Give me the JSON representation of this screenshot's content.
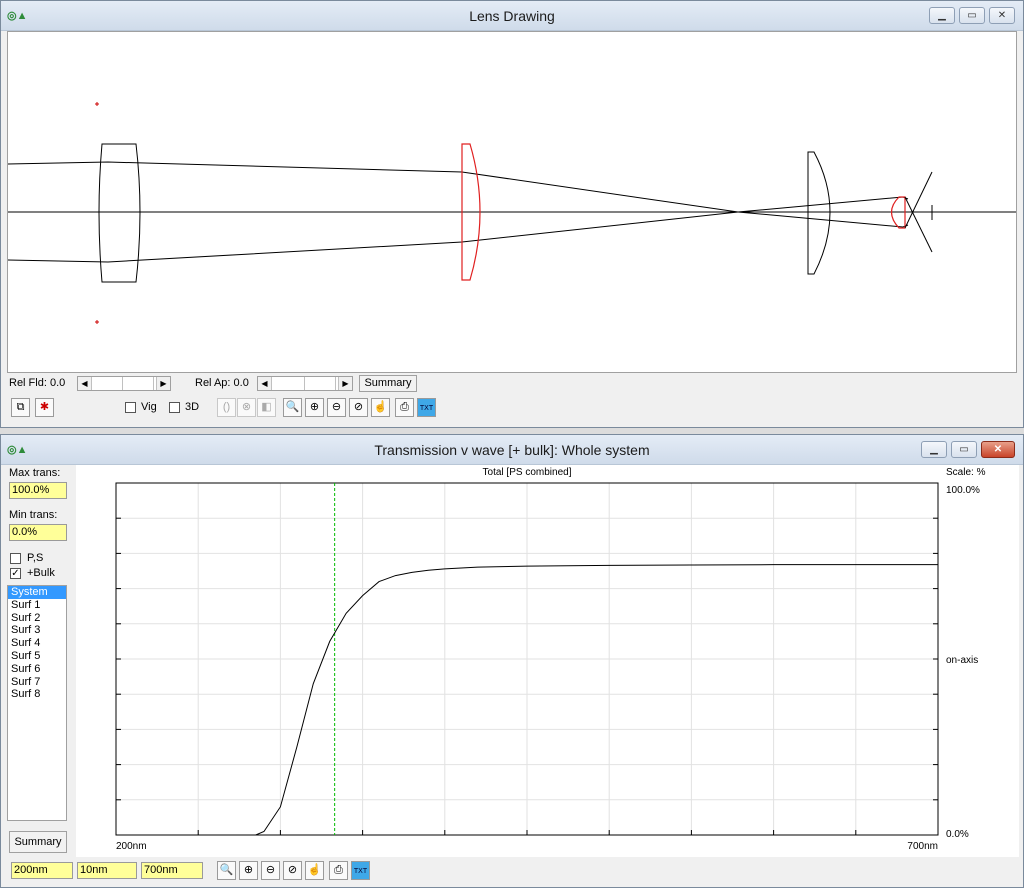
{
  "lens_window": {
    "title": "Lens Drawing",
    "rel_fld_label": "Rel Fld: 0.0",
    "rel_ap_label": "Rel Ap: 0.0",
    "summary_label": "Summary",
    "vig_label": "Vig",
    "vig_checked": false,
    "threed_label": "3D",
    "threed_checked": false
  },
  "trans_window": {
    "title": "Transmission v wave [+ bulk]: Whole system",
    "max_trans_label": "Max trans:",
    "max_trans_value": "100.0%",
    "min_trans_label": "Min trans:",
    "min_trans_value": "0.0%",
    "ps_label": "P,S",
    "ps_checked": false,
    "bulk_label": "+Bulk",
    "bulk_checked": true,
    "surfaces": [
      "System",
      "Surf 1",
      "Surf 2",
      "Surf 3",
      "Surf 4",
      "Surf 5",
      "Surf 6",
      "Surf 7",
      "Surf 8"
    ],
    "selected_surface": "System",
    "summary_label": "Summary",
    "wave_start": "200nm",
    "wave_step": "10nm",
    "wave_end": "700nm"
  },
  "chart_data": {
    "type": "line",
    "title": "Total [PS combined]",
    "scale_label": "Scale: %",
    "x_min_label": "200nm",
    "x_max_label": "700nm",
    "y_max_label": "100.0%",
    "y_min_label": "0.0%",
    "series_label": "on-axis",
    "xlim": [
      200,
      700
    ],
    "ylim": [
      0,
      100
    ],
    "grid": true,
    "marker_wavelength": 333,
    "x": [
      200,
      285,
      290,
      300,
      310,
      320,
      330,
      340,
      350,
      360,
      370,
      380,
      390,
      400,
      420,
      450,
      500,
      550,
      600,
      650,
      700
    ],
    "y": [
      0,
      0,
      1,
      8,
      25,
      43,
      55,
      63,
      68,
      72,
      73.7,
      74.6,
      75.2,
      75.6,
      76.1,
      76.4,
      76.6,
      76.7,
      76.8,
      76.8,
      76.8
    ]
  },
  "colors": {
    "accent_field": "#ffff99",
    "marker_line": "#00bb00",
    "selected_item": "#3399ff",
    "lens_highlight": "#e02020"
  }
}
